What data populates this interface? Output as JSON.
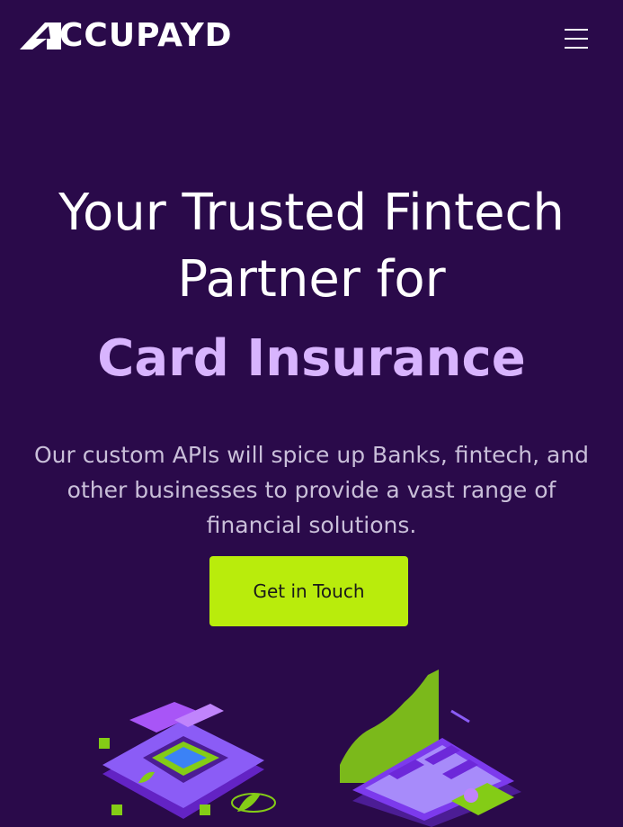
{
  "header": {
    "logo_text": "CCUPAYD",
    "logo_alt": "ACCUPAYD",
    "menu_icon": "hamburger-menu-icon"
  },
  "hero": {
    "title_line1": "Your Trusted Fintech",
    "title_line2": "Partner for",
    "highlight": "Card Insurance",
    "subtitle": "Our custom APIs will spice up Banks, fintech, and other businesses to provide a vast range of financial solutions.",
    "cta_label": "Get in Touch"
  },
  "colors": {
    "background": "#2a0a4a",
    "highlight": "#d8b4fe",
    "cta_background": "#b9ec0c",
    "subtitle": "#c9bfd9"
  },
  "illustrations": [
    "card-chip-illustration",
    "phone-chart-illustration"
  ]
}
